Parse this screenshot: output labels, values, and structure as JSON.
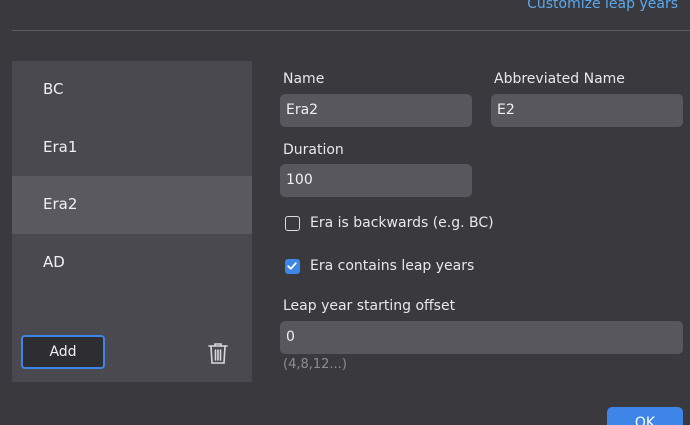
{
  "header": {
    "customize_link": "Customize leap years"
  },
  "eras": {
    "items": [
      {
        "label": "BC"
      },
      {
        "label": "Era1"
      },
      {
        "label": "Era2"
      },
      {
        "label": "AD"
      }
    ],
    "selected": "Era2",
    "add_label": "Add",
    "delete_icon": "trash-icon"
  },
  "form": {
    "name_label": "Name",
    "name_value": "Era2",
    "abbr_label": "Abbreviated Name",
    "abbr_value": "E2",
    "duration_label": "Duration",
    "duration_value": "100",
    "backwards_label": "Era is backwards (e.g. BC)",
    "backwards_checked": false,
    "leap_label": "Era contains leap years",
    "leap_checked": true,
    "offset_label": "Leap year starting offset",
    "offset_value": "0",
    "offset_hint": "(4,8,12...)"
  },
  "footer": {
    "ok_label": "OK"
  },
  "colors": {
    "accent": "#3d86e8",
    "link": "#5aa9ef",
    "background": "#3a393e",
    "panel": "#4a494f",
    "selected_row": "#5a595f",
    "input_bg": "#58575d"
  }
}
